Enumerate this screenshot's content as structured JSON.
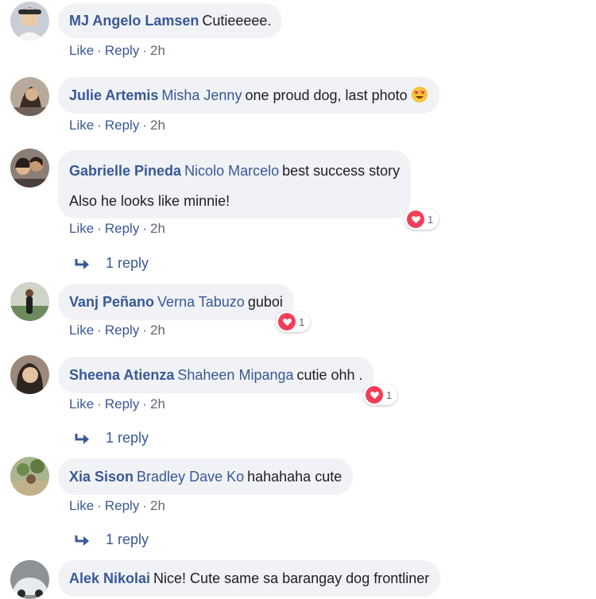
{
  "comments": [
    {
      "author": "MJ Angelo Lamsen",
      "tag": "",
      "text": "Cutieeeee.",
      "actions": {
        "like": "Like",
        "reply": "Reply",
        "sep": "·",
        "time": "2h"
      }
    },
    {
      "author": "Julie Artemis",
      "tag": "Misha Jenny",
      "text": "one proud dog, last photo",
      "emoji": "heart-eyes-emoji",
      "actions": {
        "like": "Like",
        "reply": "Reply",
        "sep": "·",
        "time": "2h"
      }
    },
    {
      "author": "Gabrielle Pineda",
      "tag": "Nicolo Marcelo",
      "text": "best success story",
      "text_line2": "Also he looks like minnie!",
      "reaction_count": "1",
      "reply_label": "1 reply",
      "actions": {
        "like": "Like",
        "reply": "Reply",
        "sep": "·",
        "time": "2h"
      }
    },
    {
      "author": "Vanj Peñano",
      "tag": "Verna Tabuzo",
      "text": "guboi",
      "reaction_count": "1",
      "actions": {
        "like": "Like",
        "reply": "Reply",
        "sep": "·",
        "time": "2h"
      }
    },
    {
      "author": "Sheena Atienza",
      "tag": "Shaheen Mipanga",
      "text": "cutie ohh .",
      "reaction_count": "1",
      "reply_label": "1 reply",
      "actions": {
        "like": "Like",
        "reply": "Reply",
        "sep": "·",
        "time": "2h"
      }
    },
    {
      "author": "Xia Sison",
      "tag": "Bradley Dave Ko",
      "text": "hahahaha cute",
      "reply_label": "1 reply",
      "actions": {
        "like": "Like",
        "reply": "Reply",
        "sep": "·",
        "time": "2h"
      }
    },
    {
      "author": "Alek Nikolai",
      "tag": "",
      "text": "Nice! Cute same sa barangay dog frontliner"
    }
  ],
  "colors": {
    "link": "#385898",
    "bubble": "#f0f2f5",
    "meta": "#606770",
    "love": "#f33e58"
  }
}
